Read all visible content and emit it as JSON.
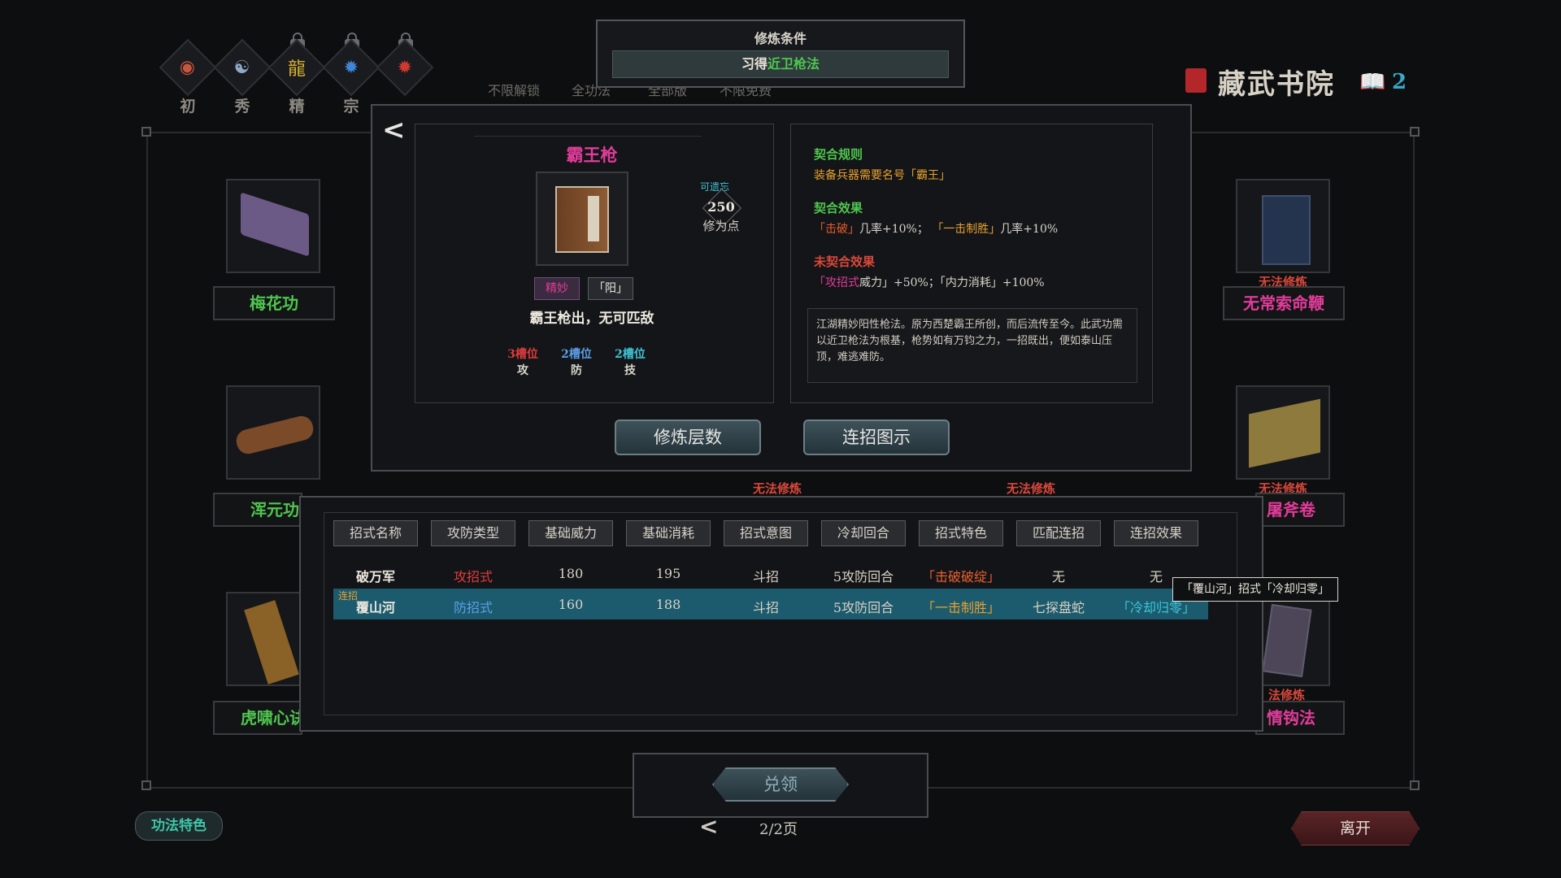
{
  "condition": {
    "title": "修炼条件",
    "prefix": "习得",
    "skill": "近卫枪法"
  },
  "realms": [
    {
      "label": "初",
      "icon": "swirl-orb-icon",
      "locked": false
    },
    {
      "label": "秀",
      "icon": "yin-yang-icon",
      "locked": false
    },
    {
      "label": "精",
      "icon": "dragon-icon",
      "locked": true
    },
    {
      "label": "宗",
      "icon": "blue-dragon-icon",
      "locked": true
    },
    {
      "label": "",
      "icon": "red-dragon-icon",
      "locked": true
    }
  ],
  "bg_tabs": [
    "不限解锁",
    "全功法",
    "全部版",
    "不限免费"
  ],
  "library": {
    "title": "藏武书院",
    "count": "2"
  },
  "left_books": [
    {
      "name": "梅花功"
    },
    {
      "name": "浑元功"
    },
    {
      "name": "虎啸心诀"
    }
  ],
  "right_books": [
    {
      "name": "无常索命鞭",
      "status": "无法修炼"
    },
    {
      "name": "屠斧卷",
      "status": "无法修炼"
    },
    {
      "name": "情钩法",
      "status": "法修炼"
    }
  ],
  "bg_cannot": [
    "无法修炼",
    "无法修炼"
  ],
  "detail": {
    "name": "霸王枪",
    "forget_label": "可遗忘",
    "points": "250",
    "points_label": "修为点",
    "tag_grade": "精妙",
    "tag_yang": "「阳」",
    "motto": "霸王枪出，无可匹敌",
    "slots": [
      {
        "top": "3槽位",
        "bottom": "攻",
        "color": "#e23c3c"
      },
      {
        "top": "2槽位",
        "bottom": "防",
        "color": "#5aa0e8"
      },
      {
        "top": "2槽位",
        "bottom": "技",
        "color": "#3ec7d8"
      }
    ],
    "rule_title": "契合规则",
    "rule_text": "装备兵器需要名号「霸王」",
    "effect_title": "契合效果",
    "effect_a": "「击破」",
    "effect_a_rest": "几率+10%；",
    "effect_b": "「一击制胜」",
    "effect_b_rest": "几率+10%",
    "uneffect_title": "未契合效果",
    "uneffect_a": "「攻招式",
    "uneffect_a_rest": "威力」+50%；「内力消耗」+100%",
    "description": "江湖精妙阳性枪法。原为西楚霸王所创，而后流传至今。此武功需以近卫枪法为根基，枪势如有万钧之力，一招既出，便如泰山压顶，难逃难防。",
    "btn_levels": "修炼层数",
    "btn_combo": "连招图示"
  },
  "table": {
    "headers": [
      "招式名称",
      "攻防类型",
      "基础威力",
      "基础消耗",
      "招式意图",
      "冷却回合",
      "招式特色",
      "匹配连招",
      "连招效果"
    ],
    "rows": [
      {
        "tag": "",
        "name": "破万军",
        "type": "攻招式",
        "power": "180",
        "cost": "195",
        "intent": "斗招",
        "cooldown": "5攻防回合",
        "feature": "「击破破绽」",
        "combo": "无",
        "effect": "无"
      },
      {
        "tag": "连招",
        "name": "覆山河",
        "type": "防招式",
        "power": "160",
        "cost": "188",
        "intent": "斗招",
        "cooldown": "5攻防回合",
        "feature": "「一击制胜」",
        "combo": "七探盘蛇",
        "effect": "「冷却归零」"
      }
    ]
  },
  "tooltip": "「覆山河」招式「冷却归零」",
  "redeem_label": "兑领",
  "page_label": "2/2页",
  "feature_label": "功法特色",
  "leave_label": "离开",
  "colors": {
    "green": "#4fc64f",
    "magenta": "#e23c9a",
    "red": "#d9483b",
    "orange": "#e8a22e",
    "highlight_row": "#1c5a6e"
  }
}
